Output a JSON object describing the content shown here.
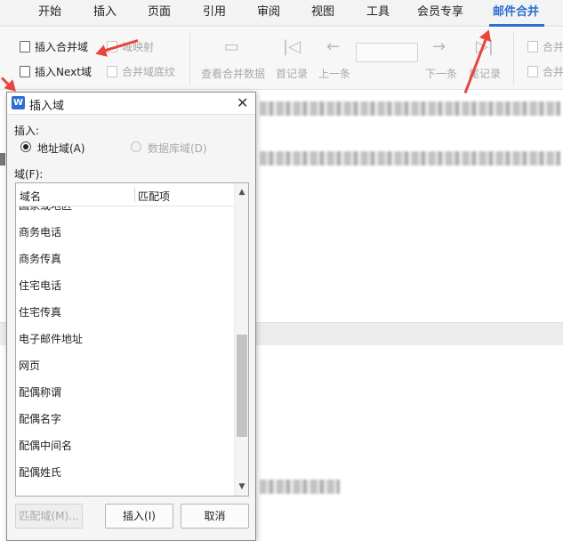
{
  "ribbon": {
    "tabs": [
      "开始",
      "插入",
      "页面",
      "引用",
      "审阅",
      "视图",
      "工具",
      "会员专享",
      "邮件合并"
    ],
    "active_tab": "邮件合并",
    "group1": {
      "insert_merge_field": "插入合并域",
      "field_mapping": "域映射",
      "insert_next": "插入Next域",
      "merge_field_shading": "合并域底纹"
    },
    "group2": {
      "view_merged_data": "查看合并数据",
      "first_record": "首记录",
      "previous": "上一条",
      "next": "下一条",
      "last_record": "尾记录"
    },
    "group3": {
      "merge_top": "合并",
      "merge_bottom": "合并"
    }
  },
  "dialog": {
    "logo": "W",
    "title": "插入域",
    "insert_label": "插入:",
    "radio_address": "地址域(A)",
    "radio_database": "数据库域(D)",
    "field_label": "域(F):",
    "column_name": "域名",
    "column_match": "匹配项",
    "partial_row": "国家或地区",
    "fields": [
      "商务电话",
      "商务传真",
      "住宅电话",
      "住宅传真",
      "电子邮件地址",
      "网页",
      "配偶称谓",
      "配偶名字",
      "配偶中间名",
      "配偶姓氏"
    ],
    "buttons": {
      "match_field": "匹配域(M)...",
      "insert": "插入(I)",
      "cancel": "取消"
    }
  },
  "colors": {
    "accent": "#2b6fd1",
    "arrow": "#e8453c"
  }
}
